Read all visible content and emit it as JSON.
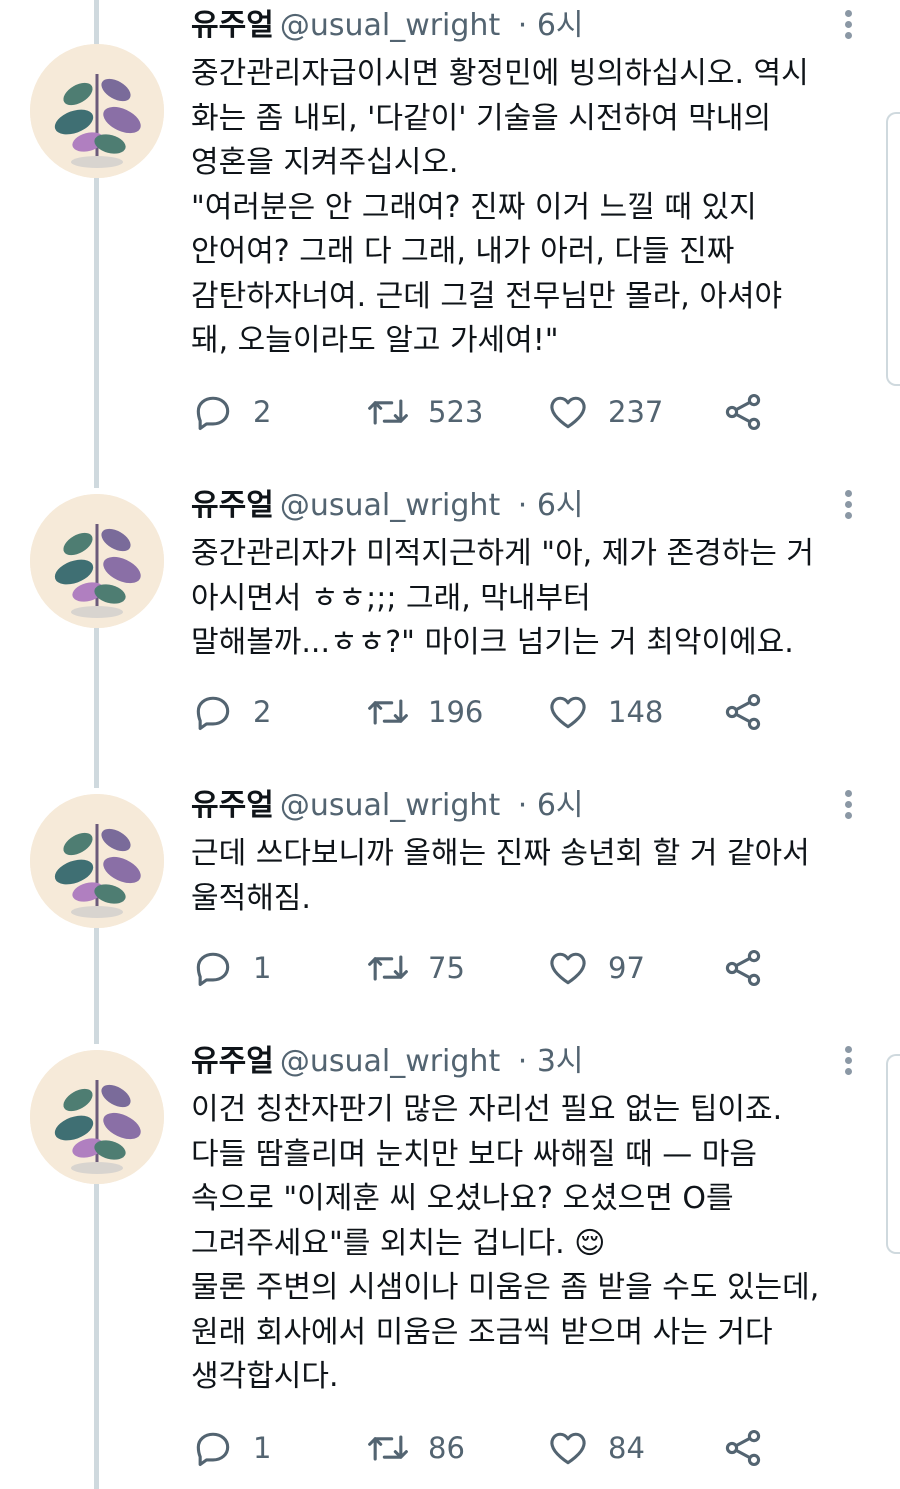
{
  "tweets": [
    {
      "name": "유주얼",
      "handle": "@usual_wright",
      "time": "· 6시",
      "lines": [
        "중간관리자급이시면 황정민에 빙의하십시오. 역시",
        "화는 좀 내되, '다같이' 기술을 시전하여 막내의",
        "영혼을 지켜주십시오.",
        "\"여러분은 안 그래여? 진짜 이거 느낄 때 있지",
        "안어여? 그래 다 그래, 내가 아러, 다들 진짜",
        "감탄하자너여. 근데 그걸 전무님만 몰라, 아셔야",
        "돼, 오늘이라도 알고 가세여!\""
      ],
      "replies": "2",
      "retweets": "523",
      "likes": "237"
    },
    {
      "name": "유주얼",
      "handle": "@usual_wright",
      "time": "· 6시",
      "lines": [
        "중간관리자가 미적지근하게 \"아, 제가 존경하는 거",
        "아시면서 ㅎㅎ;;; 그래, 막내부터",
        "말해볼까...ㅎㅎ?\" 마이크 넘기는 거 최악이에요."
      ],
      "replies": "2",
      "retweets": "196",
      "likes": "148"
    },
    {
      "name": "유주얼",
      "handle": "@usual_wright",
      "time": "· 6시",
      "lines": [
        "근데 쓰다보니까 올해는 진짜 송년회 할 거 같아서",
        "울적해짐."
      ],
      "replies": "1",
      "retweets": "75",
      "likes": "97"
    },
    {
      "name": "유주얼",
      "handle": "@usual_wright",
      "time": "· 3시",
      "lines": [
        "이건 칭찬자판기 많은 자리선 필요 없는 팁이죠.",
        "다들 땀흘리며 눈치만 보다 싸해질 때 — 마음",
        "속으로 \"이제훈 씨 오셨나요? 오셨으면 O를",
        "그려주세요\"를 외치는 겁니다. 😌",
        "물론 주변의 시샘이나 미움은 좀 받을 수도 있는데,",
        "원래 회사에서 미움은 조금씩 받으며 사는 거다",
        "생각합시다."
      ],
      "replies": "1",
      "retweets": "86",
      "likes": "84"
    }
  ],
  "icons": {
    "reply": "speech-bubble-icon",
    "retweet": "retweet-icon",
    "like": "heart-icon",
    "share": "share-icon",
    "more": "more-vertical-icon"
  },
  "colors": {
    "text": "#0f1419",
    "secondary": "#536471",
    "thread_line": "#cfd9de",
    "avatar_bg": "#f6ead9"
  }
}
